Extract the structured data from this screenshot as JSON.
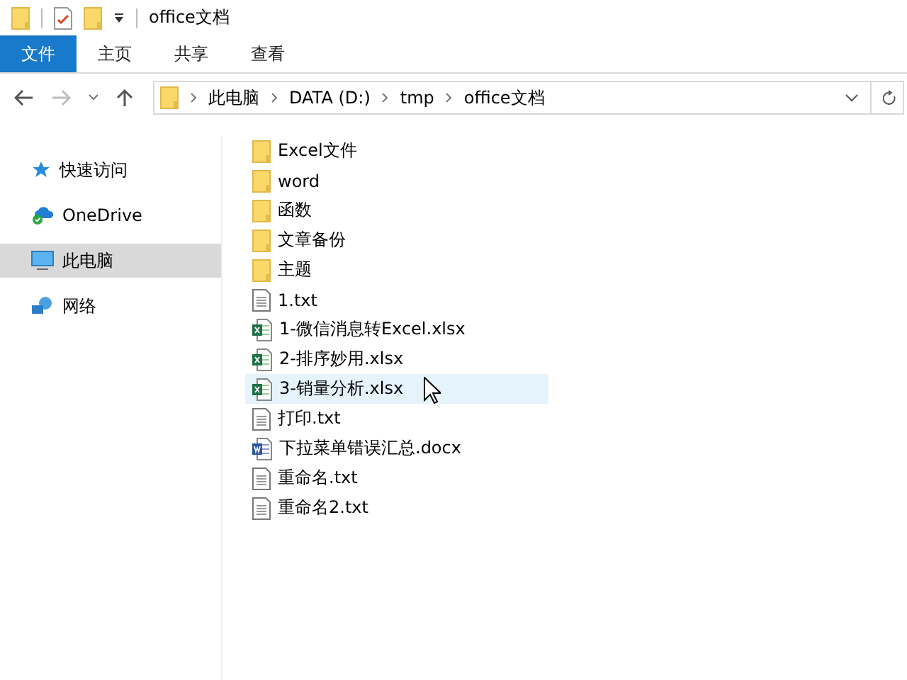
{
  "window": {
    "title": "office文档"
  },
  "ribbon_tabs": [
    {
      "label": "文件",
      "kind": "file"
    },
    {
      "label": "主页",
      "kind": "tab"
    },
    {
      "label": "共享",
      "kind": "tab"
    },
    {
      "label": "查看",
      "kind": "tab"
    }
  ],
  "address_bar": {
    "path": [
      "此电脑",
      "DATA (D:)",
      "tmp",
      "office文档"
    ]
  },
  "sidebar": {
    "items": [
      {
        "label": "快速访问",
        "kind": "star",
        "selected": false
      },
      {
        "label": "OneDrive",
        "kind": "cloud",
        "selected": false
      },
      {
        "label": "此电脑",
        "kind": "computer",
        "selected": true
      },
      {
        "label": "网络",
        "kind": "network",
        "selected": false
      }
    ]
  },
  "files": [
    {
      "name": "Excel文件",
      "kind": "folder",
      "hovered": false
    },
    {
      "name": "word",
      "kind": "folder",
      "hovered": false
    },
    {
      "name": "函数",
      "kind": "folder",
      "hovered": false
    },
    {
      "name": "文章备份",
      "kind": "folder",
      "hovered": false
    },
    {
      "name": "主题",
      "kind": "folder",
      "hovered": false
    },
    {
      "name": "1.txt",
      "kind": "txt",
      "hovered": false
    },
    {
      "name": "1-微信消息转Excel.xlsx",
      "kind": "xlsx",
      "hovered": false
    },
    {
      "name": "2-排序妙用.xlsx",
      "kind": "xlsx",
      "hovered": false
    },
    {
      "name": "3-销量分析.xlsx",
      "kind": "xlsx",
      "hovered": true
    },
    {
      "name": "打印.txt",
      "kind": "txt",
      "hovered": false
    },
    {
      "name": "下拉菜单错误汇总.docx",
      "kind": "docx",
      "hovered": false
    },
    {
      "name": "重命名.txt",
      "kind": "txt",
      "hovered": false
    },
    {
      "name": "重命名2.txt",
      "kind": "txt",
      "hovered": false
    }
  ]
}
